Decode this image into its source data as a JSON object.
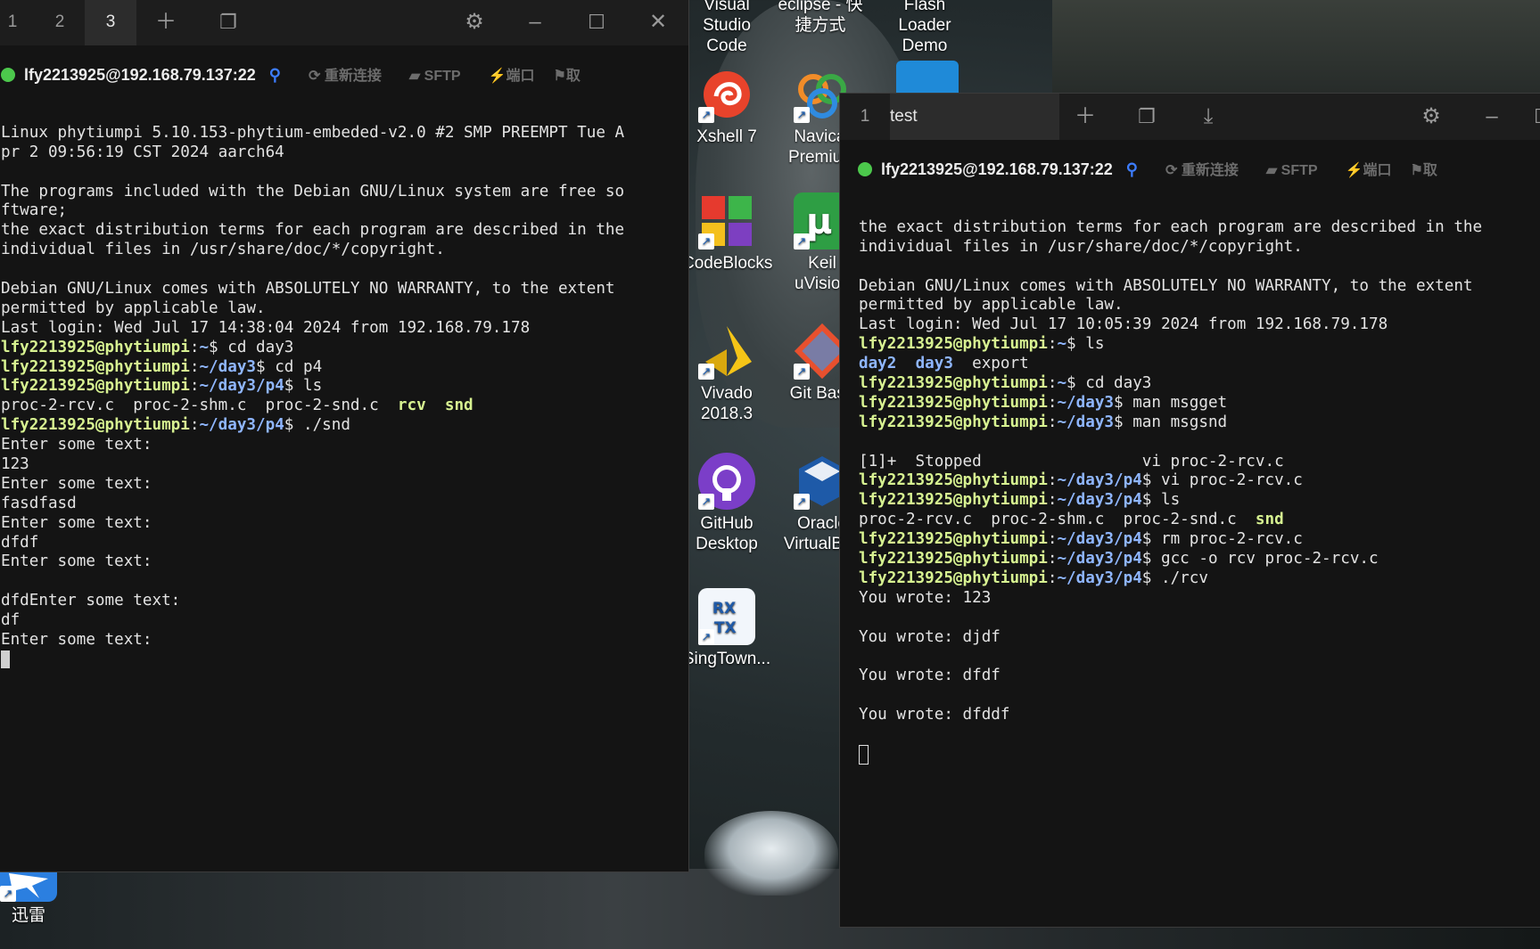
{
  "desktop": {
    "icons": [
      {
        "label": "Visual\nStudio Code"
      },
      {
        "label": "eclipse - 快\n捷方式"
      },
      {
        "label": "Flash Loader\nDemo"
      },
      {
        "label": "Xshell 7"
      },
      {
        "label": "Navicat\nPremium"
      },
      {
        "label": "CodeBlocks"
      },
      {
        "label": "Keil\nuVision"
      },
      {
        "label": "Vivado\n2018.3"
      },
      {
        "label": "Git Bash"
      },
      {
        "label": "GitHub\nDesktop"
      },
      {
        "label": "Oracle\nVirtualBox"
      },
      {
        "label": "SingTown..."
      },
      {
        "label": "迅雷"
      }
    ]
  },
  "left_window": {
    "tabs": [
      "1",
      "2",
      "3"
    ],
    "session": {
      "host": "lfy2213925@192.168.79.137:22",
      "actions": [
        "重新连接",
        "SFTP",
        "端口",
        "取"
      ]
    },
    "terminal": {
      "lines": [
        {
          "text": ""
        },
        {
          "text": "Linux phytiumpi 5.10.153-phytium-embeded-v2.0 #2 SMP PREEMPT Tue A"
        },
        {
          "text": "pr 2 09:56:19 CST 2024 aarch64"
        },
        {
          "text": ""
        },
        {
          "text": "The programs included with the Debian GNU/Linux system are free so"
        },
        {
          "text": "ftware;"
        },
        {
          "text": "the exact distribution terms for each program are described in the"
        },
        {
          "text": "individual files in /usr/share/doc/*/copyright."
        },
        {
          "text": ""
        },
        {
          "text": "Debian GNU/Linux comes with ABSOLUTELY NO WARRANTY, to the extent"
        },
        {
          "text": "permitted by applicable law."
        },
        {
          "text": "Last login: Wed Jul 17 14:38:04 2024 from 192.168.79.178"
        },
        {
          "user": "lfy2213925@phytiumpi",
          "path": "~",
          "cmd": "cd day3"
        },
        {
          "user": "lfy2213925@phytiumpi",
          "path": "~/day3",
          "cmd": "cd p4"
        },
        {
          "user": "lfy2213925@phytiumpi",
          "path": "~/day3/p4",
          "cmd": "ls"
        },
        {
          "files": [
            {
              "name": "proc-2-rcv.c",
              "type": "file"
            },
            {
              "name": "proc-2-shm.c",
              "type": "file"
            },
            {
              "name": "proc-2-snd.c",
              "type": "file"
            },
            {
              "name": "rcv",
              "type": "exe"
            },
            {
              "name": "snd",
              "type": "exe"
            }
          ]
        },
        {
          "user": "lfy2213925@phytiumpi",
          "path": "~/day3/p4",
          "cmd": "./snd"
        },
        {
          "text": "Enter some text:"
        },
        {
          "text": "123"
        },
        {
          "text": "Enter some text:"
        },
        {
          "text": "fasdfasd"
        },
        {
          "text": "Enter some text:"
        },
        {
          "text": "dfdf"
        },
        {
          "text": "Enter some text:"
        },
        {
          "text": ""
        },
        {
          "text": "dfdEnter some text:"
        },
        {
          "text": "df"
        },
        {
          "text": "Enter some text:"
        },
        {
          "cursor": "block"
        }
      ]
    }
  },
  "right_window": {
    "tabs": [
      "1",
      "test"
    ],
    "session": {
      "host": "lfy2213925@192.168.79.137:22",
      "actions": [
        "重新连接",
        "SFTP",
        "端口",
        "取"
      ]
    },
    "terminal": {
      "lines": [
        {
          "text": ""
        },
        {
          "text": "the exact distribution terms for each program are described in the"
        },
        {
          "text": "individual files in /usr/share/doc/*/copyright."
        },
        {
          "text": ""
        },
        {
          "text": "Debian GNU/Linux comes with ABSOLUTELY NO WARRANTY, to the extent"
        },
        {
          "text": "permitted by applicable law."
        },
        {
          "text": "Last login: Wed Jul 17 10:05:39 2024 from 192.168.79.178"
        },
        {
          "user": "lfy2213925@phytiumpi",
          "path": "~",
          "cmd": "ls"
        },
        {
          "files": [
            {
              "name": "day2",
              "type": "dir"
            },
            {
              "name": "day3",
              "type": "dir"
            },
            {
              "name": "export",
              "type": "file"
            }
          ]
        },
        {
          "user": "lfy2213925@phytiumpi",
          "path": "~",
          "cmd": "cd day3"
        },
        {
          "user": "lfy2213925@phytiumpi",
          "path": "~/day3",
          "cmd": "man msgget"
        },
        {
          "user": "lfy2213925@phytiumpi",
          "path": "~/day3",
          "cmd": "man msgsnd"
        },
        {
          "text": ""
        },
        {
          "text": "[1]+  Stopped                 vi proc-2-rcv.c"
        },
        {
          "user": "lfy2213925@phytiumpi",
          "path": "~/day3/p4",
          "cmd": "vi proc-2-rcv.c"
        },
        {
          "user": "lfy2213925@phytiumpi",
          "path": "~/day3/p4",
          "cmd": "ls"
        },
        {
          "files": [
            {
              "name": "proc-2-rcv.c",
              "type": "file"
            },
            {
              "name": "proc-2-shm.c",
              "type": "file"
            },
            {
              "name": "proc-2-snd.c",
              "type": "file"
            },
            {
              "name": "snd",
              "type": "exe"
            }
          ]
        },
        {
          "user": "lfy2213925@phytiumpi",
          "path": "~/day3/p4",
          "cmd": "rm proc-2-rcv.c"
        },
        {
          "user": "lfy2213925@phytiumpi",
          "path": "~/day3/p4",
          "cmd": "gcc -o rcv proc-2-rcv.c"
        },
        {
          "user": "lfy2213925@phytiumpi",
          "path": "~/day3/p4",
          "cmd": "./rcv"
        },
        {
          "text": "You wrote: 123"
        },
        {
          "text": ""
        },
        {
          "text": "You wrote: djdf"
        },
        {
          "text": ""
        },
        {
          "text": "You wrote: dfdf"
        },
        {
          "text": ""
        },
        {
          "text": "You wrote: dfddf"
        },
        {
          "text": ""
        },
        {
          "cursor": "hollow"
        }
      ]
    }
  },
  "colors": {
    "terminal_bg": "#141414",
    "user_prompt": "#d7f291",
    "path_prompt": "#8fb6ff",
    "status_dot": "#4cc84c"
  }
}
